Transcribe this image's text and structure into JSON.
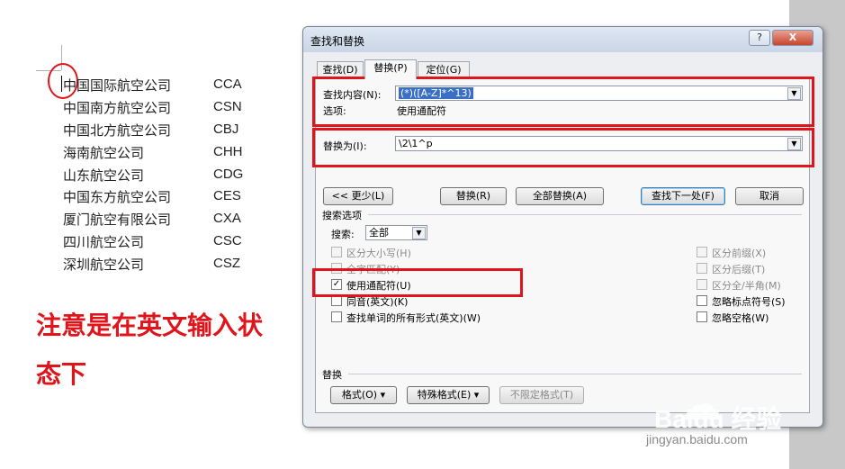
{
  "document": {
    "rows": [
      {
        "name": "中国国际航空公司",
        "code": "CCA"
      },
      {
        "name": "中国南方航空公司",
        "code": "CSN"
      },
      {
        "name": "中国北方航空公司",
        "code": "CBJ"
      },
      {
        "name": "海南航空公司",
        "code": "CHH"
      },
      {
        "name": "山东航空公司",
        "code": "CDG"
      },
      {
        "name": "中国东方航空公司",
        "code": "CES"
      },
      {
        "name": "厦门航空有限公司",
        "code": "CXA"
      },
      {
        "name": "四川航空公司",
        "code": "CSC"
      },
      {
        "name": "深圳航空公司",
        "code": "CSZ"
      }
    ],
    "note_line1": "注意是在英文输入状",
    "note_line2": "态下"
  },
  "dialog": {
    "title": "查找和替换",
    "help_label": "?",
    "close_label": "X",
    "tabs": [
      "查找(D)",
      "替换(P)",
      "定位(G)"
    ],
    "active_tab": 1,
    "find_label": "查找内容(N):",
    "find_value": "(*)([A-Z]*^13)",
    "options_label": "选项:",
    "options_value": "使用通配符",
    "replace_label": "替换为(I):",
    "replace_value": "\\2\\1^p",
    "less_button": "<< 更少(L)",
    "replace_button": "替换(R)",
    "replace_all_button": "全部替换(A)",
    "find_next_button": "查找下一处(F)",
    "cancel_button": "取消",
    "search_options_title": "搜索选项",
    "search_label": "搜索:",
    "search_value": "全部",
    "left_checks": [
      {
        "label": "区分大小写(H)",
        "checked": false,
        "disabled": true
      },
      {
        "label": "全字匹配(Y)",
        "checked": false,
        "disabled": true
      },
      {
        "label": "使用通配符(U)",
        "checked": true,
        "disabled": false
      },
      {
        "label": "同音(英文)(K)",
        "checked": false,
        "disabled": false
      },
      {
        "label": "查找单词的所有形式(英文)(W)",
        "checked": false,
        "disabled": false
      }
    ],
    "right_checks": [
      {
        "label": "区分前缀(X)",
        "checked": false,
        "disabled": true
      },
      {
        "label": "区分后缀(T)",
        "checked": false,
        "disabled": true
      },
      {
        "label": "区分全/半角(M)",
        "checked": false,
        "disabled": true
      },
      {
        "label": "忽略标点符号(S)",
        "checked": false,
        "disabled": false
      },
      {
        "label": "忽略空格(W)",
        "checked": false,
        "disabled": false
      }
    ],
    "replace_section_title": "替换",
    "format_button": "格式(O) ▾",
    "special_button": "特殊格式(E) ▾",
    "no_format_button": "不限定格式(T)"
  },
  "watermark": {
    "brand": "Baidu 经验",
    "url": "jingyan.baidu.com"
  },
  "colors": {
    "annotation_red": "#e0141b",
    "selection_blue": "#3a6fc4"
  }
}
